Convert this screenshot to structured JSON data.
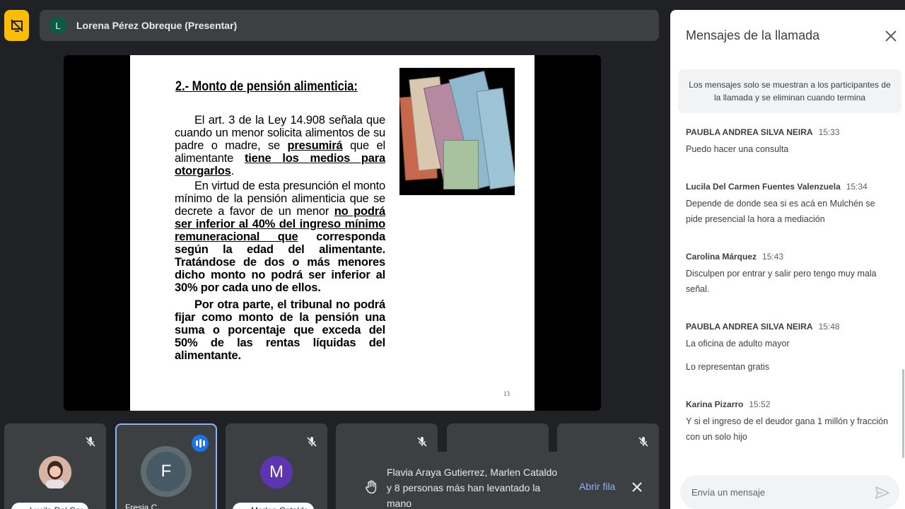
{
  "header": {
    "presenter_initial": "L",
    "presenter_label": "Lorena Pérez Obreque (Presentar)",
    "present_icon": "stop-presenting-icon"
  },
  "slide": {
    "title": "2.- Monto de pensión alimenticia:",
    "p1_a": "El art. 3 de la Ley 14.908 señala que cuando un menor solicita alimentos de su padre o madre, se ",
    "p1_b": "presumirá",
    "p1_c": " que el alimentante ",
    "p1_d": "tiene los medios para otorgarlos",
    "p1_e": ".",
    "p2_a": "En virtud de esta presunción el monto mínimo de la pensión alimenticia que se decrete a favor de un menor ",
    "p2_b": "no podrá ser inferior al 40% del ingreso mínimo remuneracional que",
    "p2_c": " corresponda según la edad del alimentante. Tratándose de dos o más menores dicho monto no podrá ser inferior al 30% por cada uno de ellos.",
    "p3": "Por otra parte, el tribunal no podrá fijar como monto de la pensión una suma o porcentaje que exceda del 50% de las rentas líquidas del alimentante.",
    "page_number": "13"
  },
  "participants": [
    {
      "name": "Lucila Del Car",
      "muted": true
    },
    {
      "name": "Fresia C",
      "initial": "F",
      "speaking": true
    },
    {
      "name": "Marlen Cataldo",
      "initial": "M",
      "muted": true
    },
    {
      "muted": true
    },
    {},
    {
      "muted": true
    }
  ],
  "toast": {
    "text": "Flavia Araya Gutierrez, Marlen Cataldo y 8 personas más han levantado la mano",
    "action": "Abrir fila"
  },
  "chat": {
    "title": "Mensajes de la llamada",
    "notice": "Los mensajes solo se muestran a los participantes de la llamada y se eliminan cuando termina",
    "messages": [
      {
        "author": "PAUBLA ANDREA SILVA NEIRA",
        "time": "15:33",
        "text": "Puedo hacer una consulta"
      },
      {
        "author": "Lucila Del Carmen Fuentes Valenzuela",
        "time": "15:34",
        "text": "Depende de donde sea si es acá en Mulchén se pide presencial la hora a mediación"
      },
      {
        "author": "Carolina Márquez",
        "time": "15:43",
        "text": "Disculpen por entrar y salir pero tengo muy mala señal."
      },
      {
        "author": "PAUBLA ANDREA SILVA NEIRA",
        "time": "15:48",
        "text": "La oficina de adulto mayor",
        "text2": "Lo representan gratis"
      },
      {
        "author": "Karina Pizarro",
        "time": "15:52",
        "text": "Y si el ingreso de el deudor gana 1 millón y fracción con un solo hijo"
      }
    ],
    "input_placeholder": "Envía un mensaje"
  },
  "colors": {
    "background": "#202124",
    "accent": "#8ab4f8",
    "present": "#fbbc04",
    "speaking": "#1a73e8"
  }
}
